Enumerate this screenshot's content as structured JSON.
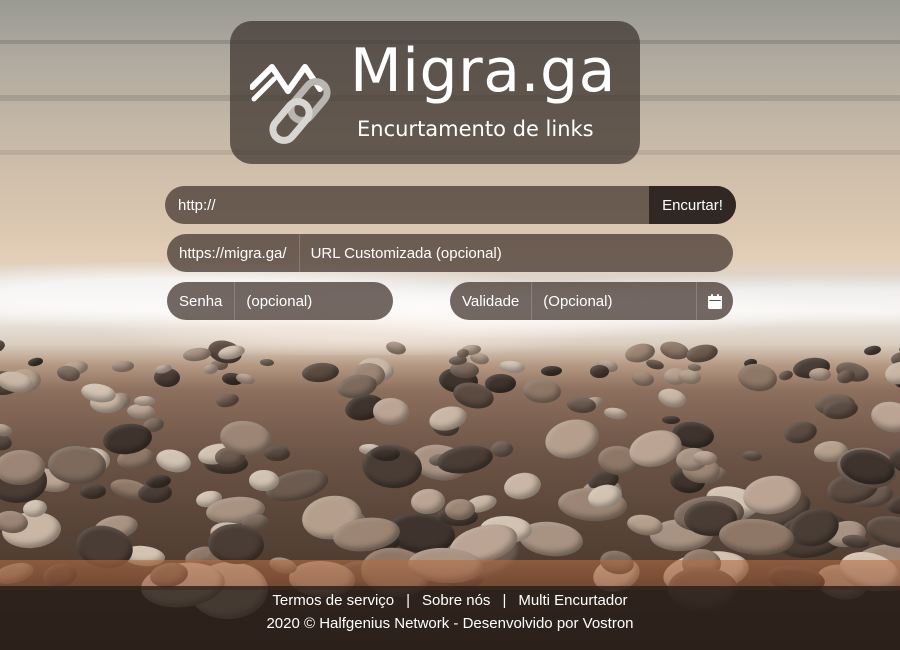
{
  "logo": {
    "title": "Migra.ga",
    "subtitle": "Encurtamento de links",
    "icon": "chain-link-logo-icon"
  },
  "shorten": {
    "url_value": "http://",
    "button_label": "Encurtar!"
  },
  "custom": {
    "prefix": "https://migra.ga/",
    "placeholder": "URL Customizada (opcional)"
  },
  "password": {
    "label": "Senha",
    "placeholder": "(opcional)"
  },
  "validity": {
    "label": "Validade",
    "placeholder": "(Opcional)",
    "icon": "calendar-icon"
  },
  "footer": {
    "links": [
      "Termos de serviço",
      "Sobre nós",
      "Multi Encurtador"
    ],
    "separator": "|",
    "copyright": "2020 © Halfgenius Network - Desenvolvido por Vostron"
  },
  "colors": {
    "panel": "#4b3e37",
    "button": "#2d2420",
    "text": "#ffffff"
  }
}
